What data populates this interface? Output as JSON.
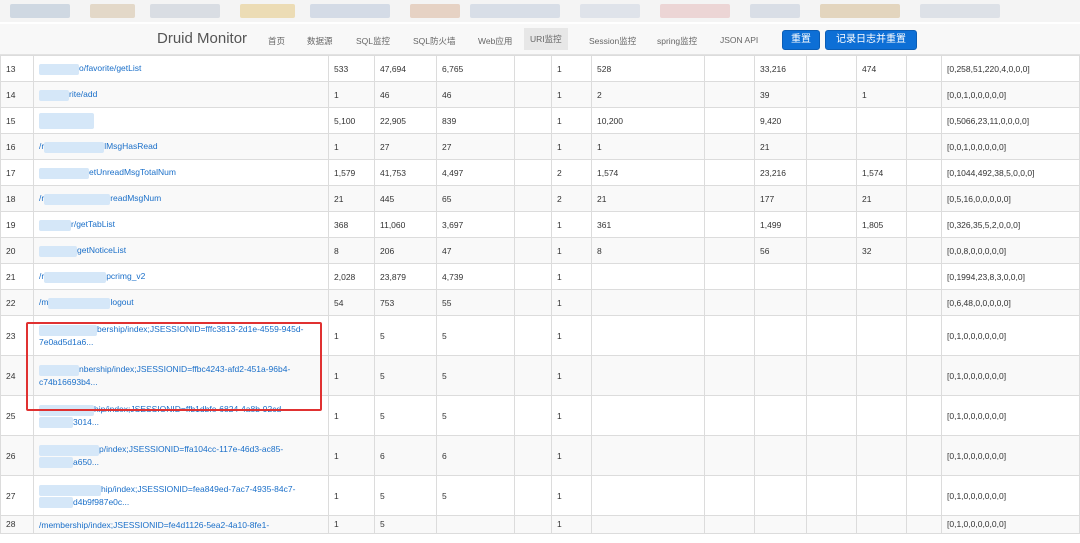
{
  "header": {
    "brand": "Druid Monitor",
    "nav": [
      "首页",
      "数据源",
      "SQL监控",
      "SQL防火墙",
      "Web应用",
      "URI监控",
      "Session监控",
      "spring监控",
      "JSON API"
    ],
    "active_nav": "URI监控",
    "reset_button": "重置",
    "log_reset_button": "记录日志并重置"
  },
  "accent": "#0d6fd6",
  "highlight_color": "#e03131",
  "rows": [
    {
      "n": "13",
      "uri": "o/favorite/getList",
      "c1": "533",
      "c2": "47,694",
      "c3": "6,765",
      "c4": "1",
      "c5": "528",
      "c6": "33,216",
      "c7": "474",
      "dist": "[0,258,51,220,4,0,0,0]"
    },
    {
      "n": "14",
      "uri": "rite/add",
      "c1": "1",
      "c2": "46",
      "c3": "46",
      "c4": "1",
      "c5": "2",
      "c6": "39",
      "c7": "1",
      "dist": "[0,0,1,0,0,0,0,0]"
    },
    {
      "n": "15",
      "uri": "",
      "c1": "5,100",
      "c2": "22,905",
      "c3": "839",
      "c4": "1",
      "c5": "10,200",
      "c6": "9,420",
      "c7": "",
      "dist": "[0,5066,23,11,0,0,0,0]"
    },
    {
      "n": "16",
      "uri": "/r",
      "uri2": "lMsgHasRead",
      "c1": "1",
      "c2": "27",
      "c3": "27",
      "c4": "1",
      "c5": "1",
      "c6": "21",
      "c7": "",
      "dist": "[0,0,1,0,0,0,0,0]"
    },
    {
      "n": "17",
      "uri": "etUnreadMsgTotalNum",
      "c1": "1,579",
      "c2": "41,753",
      "c3": "4,497",
      "c4": "2",
      "c5": "1,574",
      "c6": "23,216",
      "c7": "1,574",
      "dist": "[0,1044,492,38,5,0,0,0]"
    },
    {
      "n": "18",
      "uri": "/r",
      "uri2": "readMsgNum",
      "c1": "21",
      "c2": "445",
      "c3": "65",
      "c4": "2",
      "c5": "21",
      "c6": "177",
      "c7": "21",
      "dist": "[0,5,16,0,0,0,0,0]"
    },
    {
      "n": "19",
      "uri": "r/getTabList",
      "c1": "368",
      "c2": "11,060",
      "c3": "3,697",
      "c4": "1",
      "c5": "361",
      "c6": "1,499",
      "c7": "1,805",
      "dist": "[0,326,35,5,2,0,0,0]"
    },
    {
      "n": "20",
      "uri": "getNoticeList",
      "c1": "8",
      "c2": "206",
      "c3": "47",
      "c4": "1",
      "c5": "8",
      "c6": "56",
      "c7": "32",
      "dist": "[0,0,8,0,0,0,0,0]"
    },
    {
      "n": "21",
      "uri": "/r",
      "uri2": "pcrimg_v2",
      "c1": "2,028",
      "c2": "23,879",
      "c3": "4,739",
      "c4": "1",
      "c5": "",
      "c6": "",
      "c7": "",
      "dist": "[0,1994,23,8,3,0,0,0]"
    },
    {
      "n": "22",
      "uri": "/m",
      "uri2": "logout",
      "c1": "54",
      "c2": "753",
      "c3": "55",
      "c4": "1",
      "c5": "",
      "c6": "",
      "c7": "",
      "dist": "[0,6,48,0,0,0,0,0]"
    },
    {
      "n": "23",
      "uri": "bership/index;JSESSIONID=fffc3813-2d1e-4559-945d-",
      "uri2": "7e0ad5d1a6...",
      "c1": "1",
      "c2": "5",
      "c3": "5",
      "c4": "1",
      "c5": "",
      "c6": "",
      "c7": "",
      "dist": "[0,1,0,0,0,0,0,0]"
    },
    {
      "n": "24",
      "uri": "nbership/index;JSESSIONID=ffbc4243-afd2-451a-96b4-",
      "uri2": "c74b16693b4...",
      "c1": "1",
      "c2": "5",
      "c3": "5",
      "c4": "1",
      "c5": "",
      "c6": "",
      "c7": "",
      "dist": "[0,1,0,0,0,0,0,0]"
    },
    {
      "n": "25",
      "uri": "hip/index;JSESSIONID=ffb1dbfe-6824-4a8b-92cd-",
      "uri2": "3014...",
      "c1": "1",
      "c2": "5",
      "c3": "5",
      "c4": "1",
      "c5": "",
      "c6": "",
      "c7": "",
      "dist": "[0,1,0,0,0,0,0,0]"
    },
    {
      "n": "26",
      "uri": "p/index;JSESSIONID=ffa104cc-117e-46d3-ac85-",
      "uri2": "a650...",
      "c1": "1",
      "c2": "6",
      "c3": "6",
      "c4": "1",
      "c5": "",
      "c6": "",
      "c7": "",
      "dist": "[0,1,0,0,0,0,0,0]"
    },
    {
      "n": "27",
      "uri": "hip/index;JSESSIONID=fea849ed-7ac7-4935-84c7-",
      "uri2": "d4b9f987e0c...",
      "c1": "1",
      "c2": "5",
      "c3": "5",
      "c4": "1",
      "c5": "",
      "c6": "",
      "c7": "",
      "dist": "[0,1,0,0,0,0,0,0]"
    },
    {
      "n": "28",
      "uri": "/membership/index;JSESSIONID=fe4d1126-5ea2-4a10-8fe1-",
      "c1": "1",
      "c2": "5",
      "c3": "",
      "c4": "1",
      "c5": "",
      "c6": "",
      "c7": "",
      "dist": "[0,1,0,0,0,0,0,0]"
    }
  ]
}
